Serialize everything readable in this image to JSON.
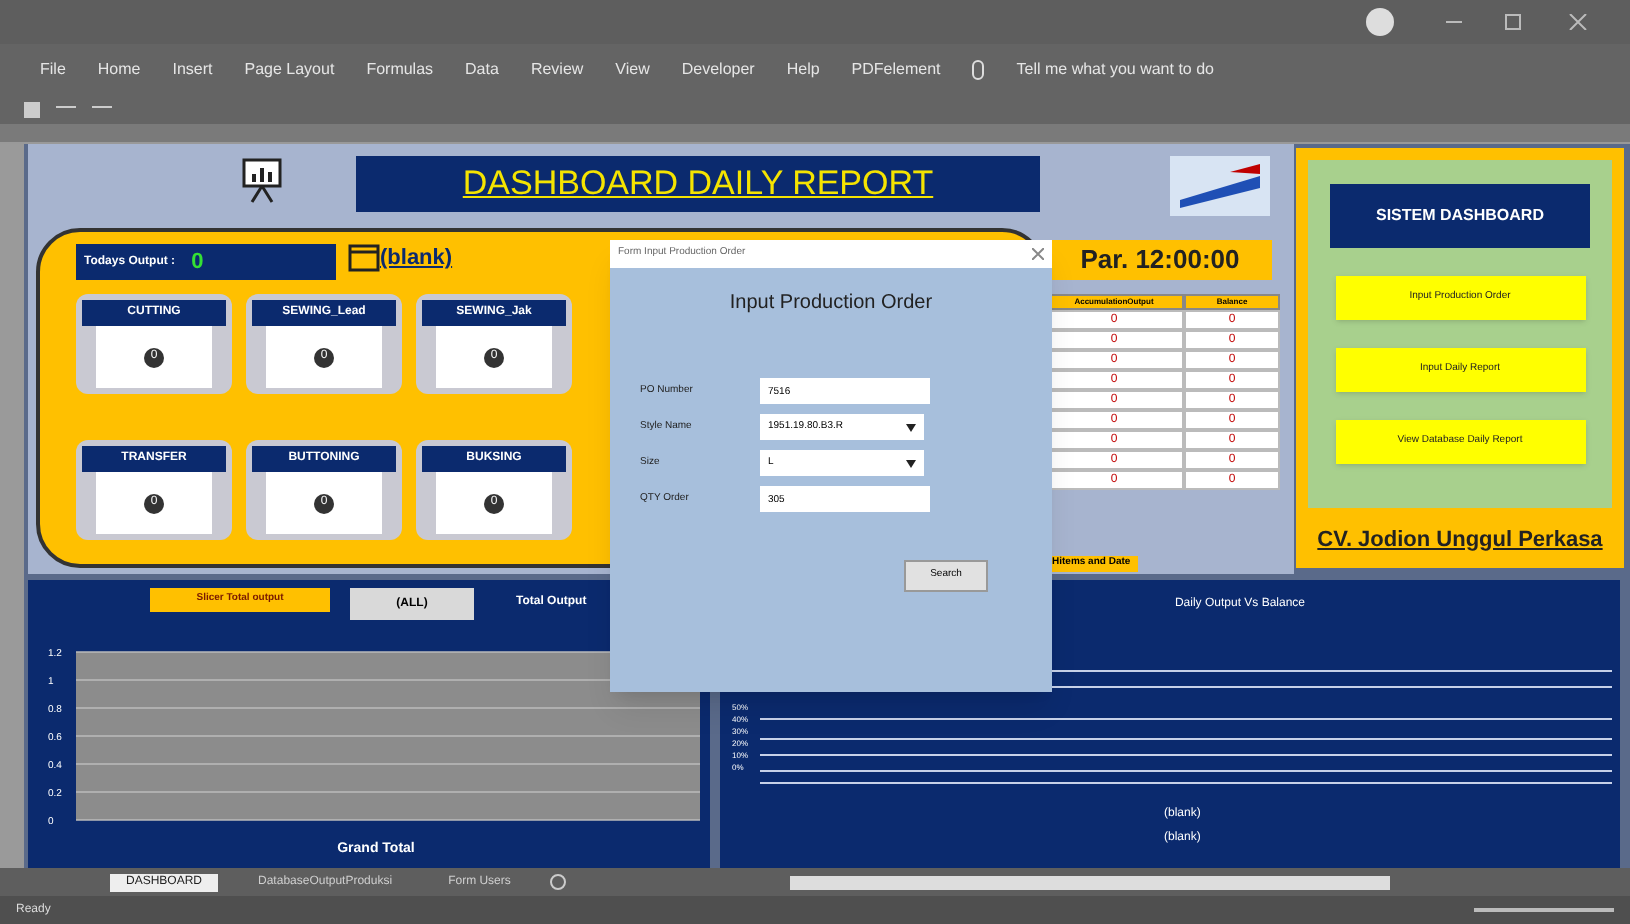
{
  "ribbon": {
    "tabs": [
      "File",
      "Home",
      "Insert",
      "Page Layout",
      "Formulas",
      "Data",
      "Review",
      "View",
      "Developer",
      "Help",
      "PDFelement"
    ],
    "tell_me": "Tell me what you want to do"
  },
  "dashboard": {
    "title": "DASHBOARD DAILY REPORT",
    "todays_output_label": "Todays Output :",
    "todays_output": "0",
    "date": "(blank)",
    "time": "Par. 12:00:00",
    "departments": [
      {
        "name": "CUTTING",
        "value": "0"
      },
      {
        "name": "SEWING_Lead",
        "value": "0"
      },
      {
        "name": "SEWING_Jak",
        "value": "0"
      },
      {
        "name": "TRANSFER",
        "value": "0"
      },
      {
        "name": "BUTTONING",
        "value": "0"
      },
      {
        "name": "BUKSING",
        "value": "0"
      }
    ],
    "table": {
      "columns": [
        "AccumulationOutput",
        "Balance"
      ],
      "rows": [
        [
          "0",
          "0"
        ],
        [
          "0",
          "0"
        ],
        [
          "0",
          "0"
        ],
        [
          "0",
          "0"
        ],
        [
          "0",
          "0"
        ],
        [
          "0",
          "0"
        ],
        [
          "0",
          "0"
        ],
        [
          "0",
          "0"
        ],
        [
          "0",
          "0"
        ]
      ]
    },
    "table_note": "Hitems and Date"
  },
  "side_panel": {
    "title": "SISTEM DASHBOARD",
    "buttons": [
      "Input Production Order",
      "Input Daily Report",
      "View Database Daily Report"
    ],
    "company": "CV. Jodion Unggul Perkasa"
  },
  "output_chart": {
    "slicer_label": "Slicer Total output",
    "slicer_value": "(ALL)",
    "title": "Total Output",
    "chart_data": {
      "type": "bar",
      "categories": [
        "Grand Total"
      ],
      "values": [
        0
      ],
      "ylim": [
        0,
        1.2
      ],
      "grid": true,
      "yticks": [
        0,
        0.2,
        0.4,
        0.6,
        0.8,
        1,
        1.2
      ]
    }
  },
  "balance_chart": {
    "title": "Daily Output Vs Balance",
    "ticks": [
      "50%",
      "40%",
      "30%",
      "20%",
      "10%",
      "0%"
    ],
    "labels": [
      "(blank)",
      "(blank)"
    ]
  },
  "dialog": {
    "title": "Form Input Production Order",
    "heading": "Input Production Order",
    "fields": [
      {
        "label": "PO Number",
        "kind": "text",
        "value": "7516"
      },
      {
        "label": "Style Name",
        "kind": "dropdown",
        "value": "1951.19.80.B3.R"
      },
      {
        "label": "Size",
        "kind": "dropdown",
        "value": "L"
      },
      {
        "label": "QTY Order",
        "kind": "text",
        "value": "305"
      }
    ],
    "button": "Search"
  },
  "sheet_tabs": [
    {
      "label": "DASHBOARD",
      "selected": true
    },
    {
      "label": "DatabaseOutputProduksi",
      "selected": false
    },
    {
      "label": "Form Users",
      "selected": false
    }
  ],
  "status_bar": {
    "text": "Ready"
  }
}
